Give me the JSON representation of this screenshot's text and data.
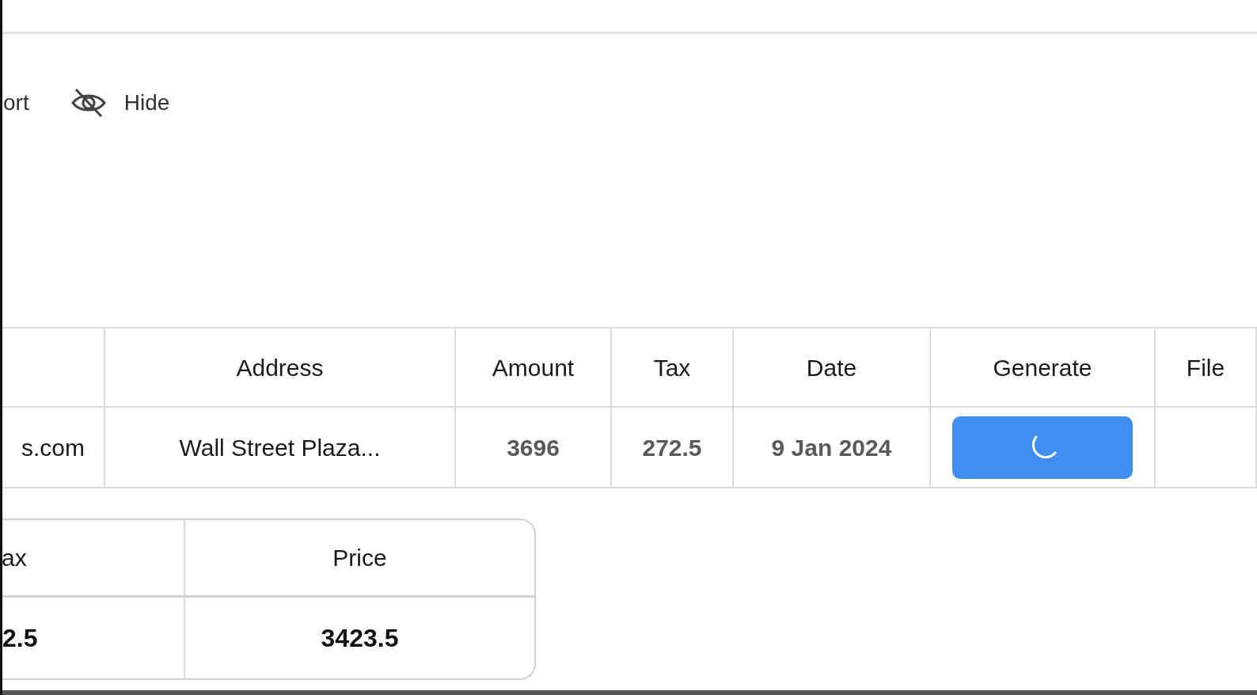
{
  "toolbar": [
    {
      "kind": "text",
      "label": "ort"
    },
    {
      "kind": "hide",
      "label": "Hide"
    }
  ],
  "table": {
    "columns": [
      {
        "kind": "blank"
      },
      {
        "kind": "text",
        "label": "Address"
      },
      {
        "kind": "text",
        "label": "Amount"
      },
      {
        "kind": "text",
        "label": "Tax"
      },
      {
        "kind": "text",
        "label": "Date"
      },
      {
        "kind": "text",
        "label": "Generate"
      },
      {
        "kind": "text",
        "label": "File"
      }
    ],
    "rows": [
      {
        "cells": [
          {
            "kind": "text",
            "text": "s.com"
          },
          {
            "kind": "text",
            "text": "Wall Street Plaza..."
          },
          {
            "kind": "number",
            "text": "3696"
          },
          {
            "kind": "number",
            "text": "272.5"
          },
          {
            "kind": "number",
            "text": "9 Jan 2024"
          },
          {
            "kind": "button",
            "loading": true
          },
          {
            "kind": "empty"
          }
        ]
      }
    ]
  },
  "summary": {
    "columns": [
      "ax",
      "Price"
    ],
    "rows": [
      [
        "2.5",
        "3423.5"
      ]
    ]
  }
}
